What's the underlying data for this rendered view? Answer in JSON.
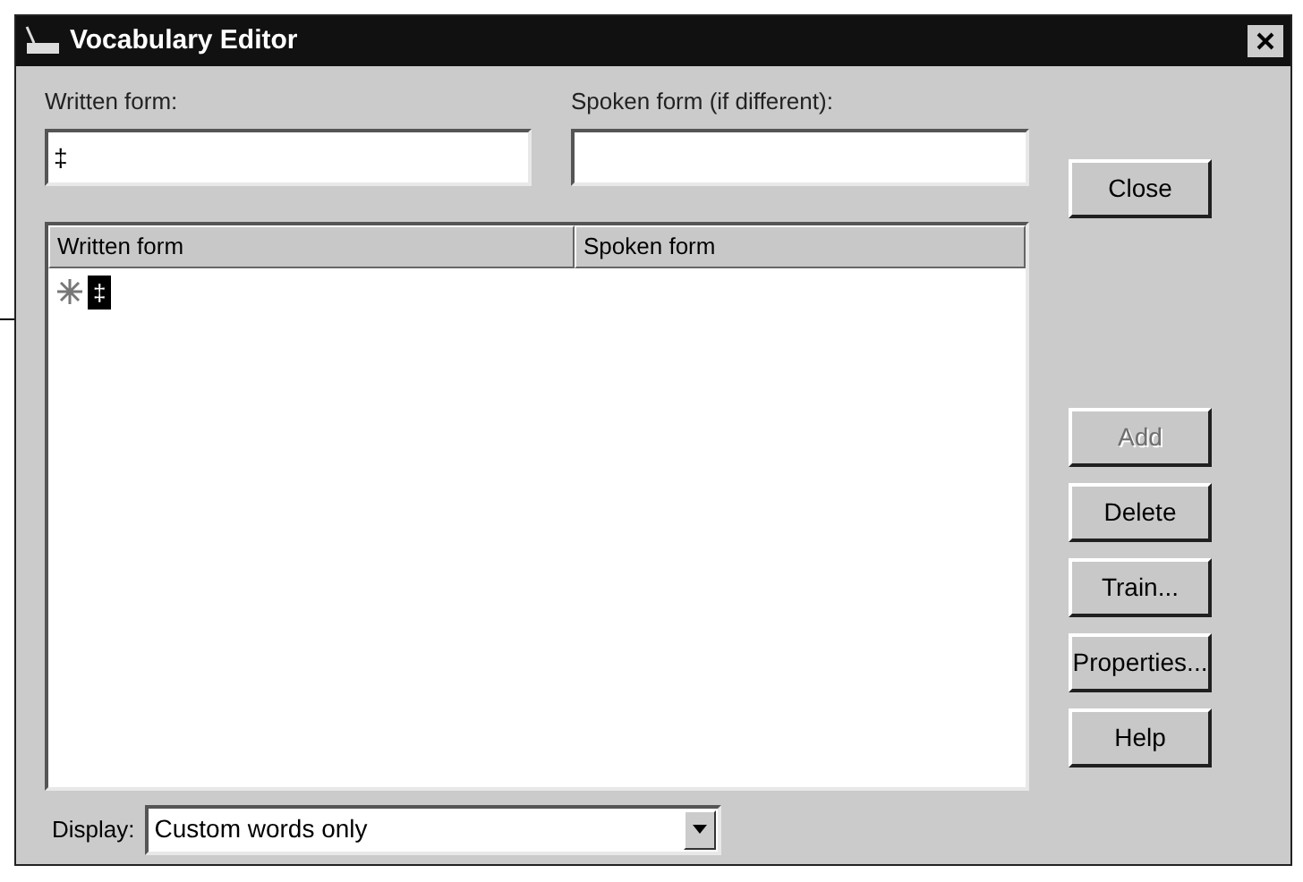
{
  "window": {
    "title": "Vocabulary Editor"
  },
  "written_field": {
    "label": "Written form:",
    "value": "‡"
  },
  "spoken_field": {
    "label": "Spoken form (if different):"
  },
  "list": {
    "columns": [
      "Written form",
      "Spoken form"
    ],
    "rows": [
      {
        "written": "‡",
        "selected": true
      }
    ]
  },
  "buttons": [
    {
      "label": "Close",
      "disabled": false
    },
    {
      "label": "Add",
      "disabled": true
    },
    {
      "label": "Delete",
      "disabled": false
    },
    {
      "label": "Train...",
      "disabled": false
    },
    {
      "label": "Properties...",
      "disabled": false
    },
    {
      "label": "Help",
      "disabled": false
    }
  ],
  "display": {
    "label": "Display:",
    "value": "Custom words only"
  }
}
